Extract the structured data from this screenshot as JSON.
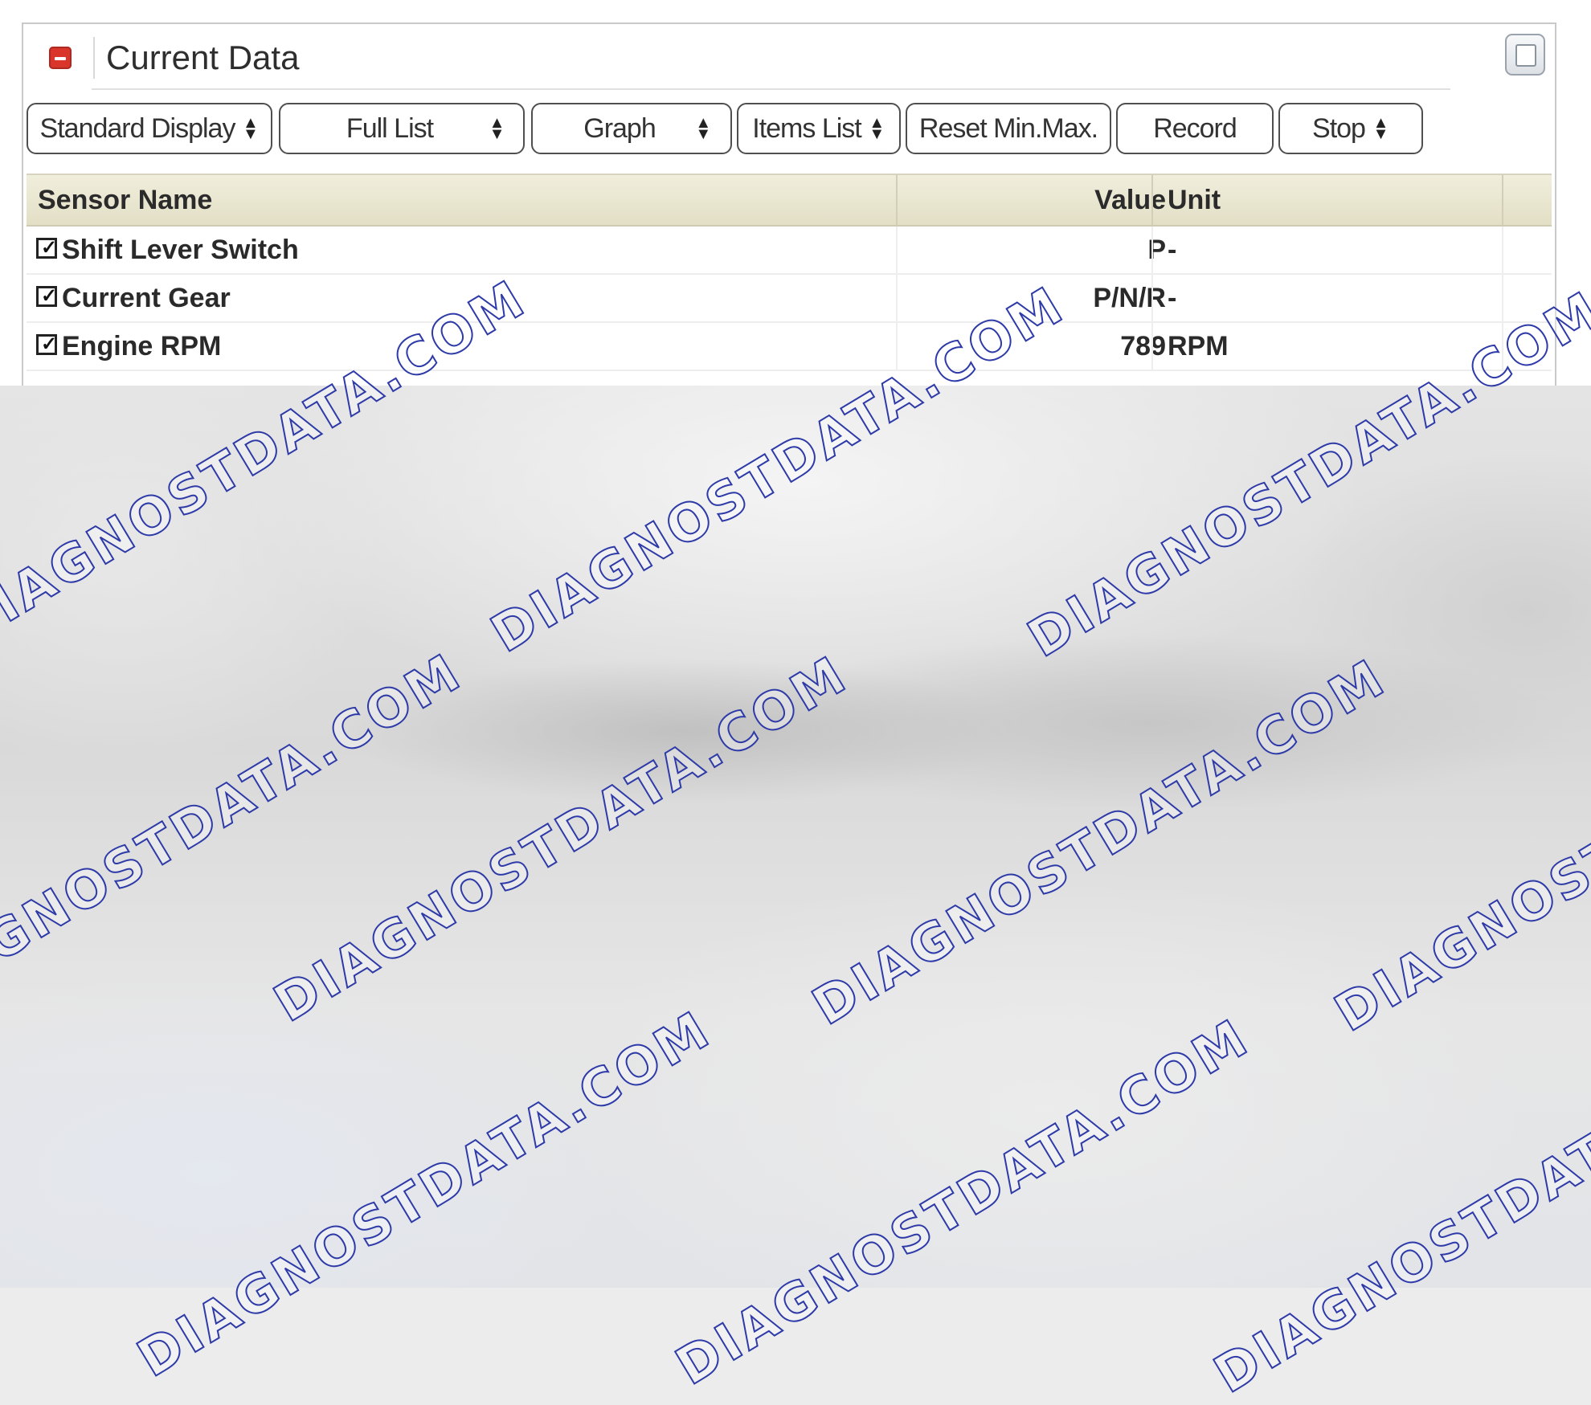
{
  "panel": {
    "title": "Current Data"
  },
  "toolbar": {
    "standard_display": "Standard Display",
    "full_list": "Full List",
    "graph": "Graph",
    "items_list": "Items List",
    "reset_min_max": "Reset Min.Max.",
    "record": "Record",
    "stop": "Stop"
  },
  "table": {
    "headers": {
      "name": "Sensor Name",
      "value": "Value",
      "unit": "Unit"
    },
    "rows": [
      {
        "checked": "☑",
        "name": "Shift Lever Switch",
        "value": "P",
        "unit": "-"
      },
      {
        "checked": "☑",
        "name": "Current Gear",
        "value": "P/N/R",
        "unit": "-"
      },
      {
        "checked": "☑",
        "name": "Engine RPM",
        "value": "789",
        "unit": "RPM"
      }
    ]
  },
  "watermark": {
    "text_a": "DIAGNOSTDATA.COM"
  },
  "colors": {
    "collapse_icon": "#d9352b",
    "header_bg": "#e9e6d1",
    "watermark_stroke": "#2d3aa8"
  }
}
